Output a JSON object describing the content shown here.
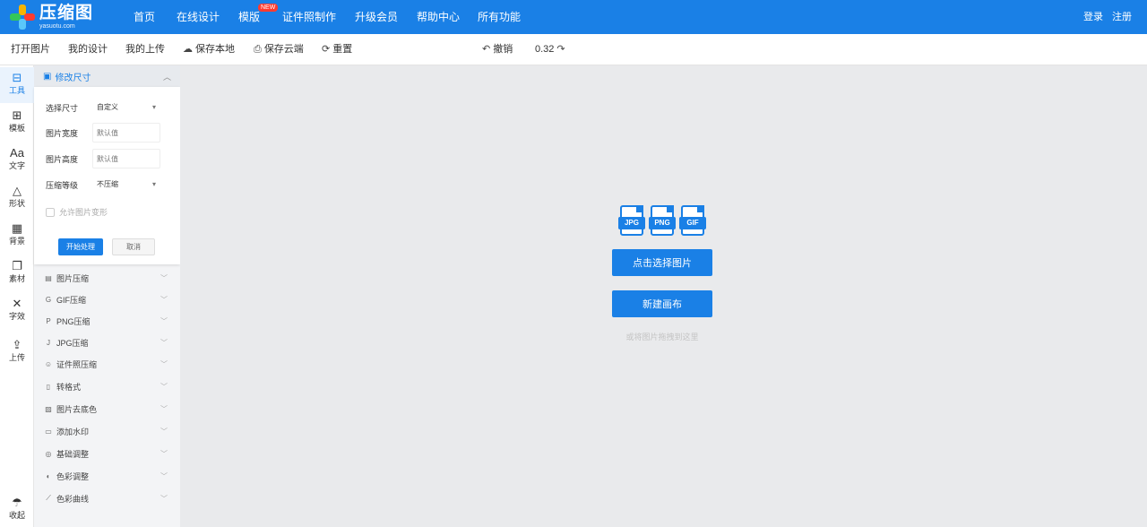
{
  "brand": {
    "name": "压缩图",
    "domain": "yasuotu.com"
  },
  "nav": {
    "items": [
      "首页",
      "在线设计",
      "模版",
      "证件照制作",
      "升级会员",
      "帮助中心",
      "所有功能"
    ],
    "new_badge": "NEW",
    "login": "登录",
    "register": "注册"
  },
  "toolbar": {
    "open_image": "打开图片",
    "my_designs": "我的设计",
    "my_uploads": "我的上传",
    "save_local": "保存本地",
    "save_cloud": "保存云端",
    "reset": "重置",
    "undo": "撤销",
    "redo": "0.32"
  },
  "rail": {
    "items": [
      {
        "label": "工具",
        "icon": "toolbox-icon"
      },
      {
        "label": "模板",
        "icon": "template-icon"
      },
      {
        "label": "文字",
        "icon": "text-icon"
      },
      {
        "label": "形状",
        "icon": "shapes-icon"
      },
      {
        "label": "背景",
        "icon": "background-icon"
      },
      {
        "label": "素材",
        "icon": "material-icon"
      },
      {
        "label": "字效",
        "icon": "font-effect-icon"
      },
      {
        "label": "上传",
        "icon": "upload-icon"
      },
      {
        "label": "收起",
        "icon": "collapse-icon"
      }
    ]
  },
  "panel": {
    "resize": {
      "header": "修改尺寸",
      "size_label": "选择尺寸",
      "size_value": "自定义",
      "width_label": "图片宽度",
      "width_placeholder": "默认值",
      "height_label": "图片高度",
      "height_placeholder": "默认值",
      "quality_label": "压缩等级",
      "quality_value": "不压缩",
      "lock_ratio": "允许图片变形",
      "start": "开始处理",
      "cancel": "取消"
    },
    "sections": [
      "图片压缩",
      "GIF压缩",
      "PNG压缩",
      "JPG压缩",
      "证件照压缩",
      "转格式",
      "图片去底色",
      "添加水印",
      "基础调整",
      "色彩调整",
      "色彩曲线"
    ]
  },
  "canvas": {
    "formats": [
      "JPG",
      "PNG",
      "GIF"
    ],
    "select_image": "点击选择图片",
    "new_canvas": "新建画布",
    "drag_hint": "或将图片拖拽到这里"
  },
  "colors": {
    "primary": "#1a80e6",
    "canvas_bg": "#e9eaec",
    "badge": "#ff3b30"
  }
}
